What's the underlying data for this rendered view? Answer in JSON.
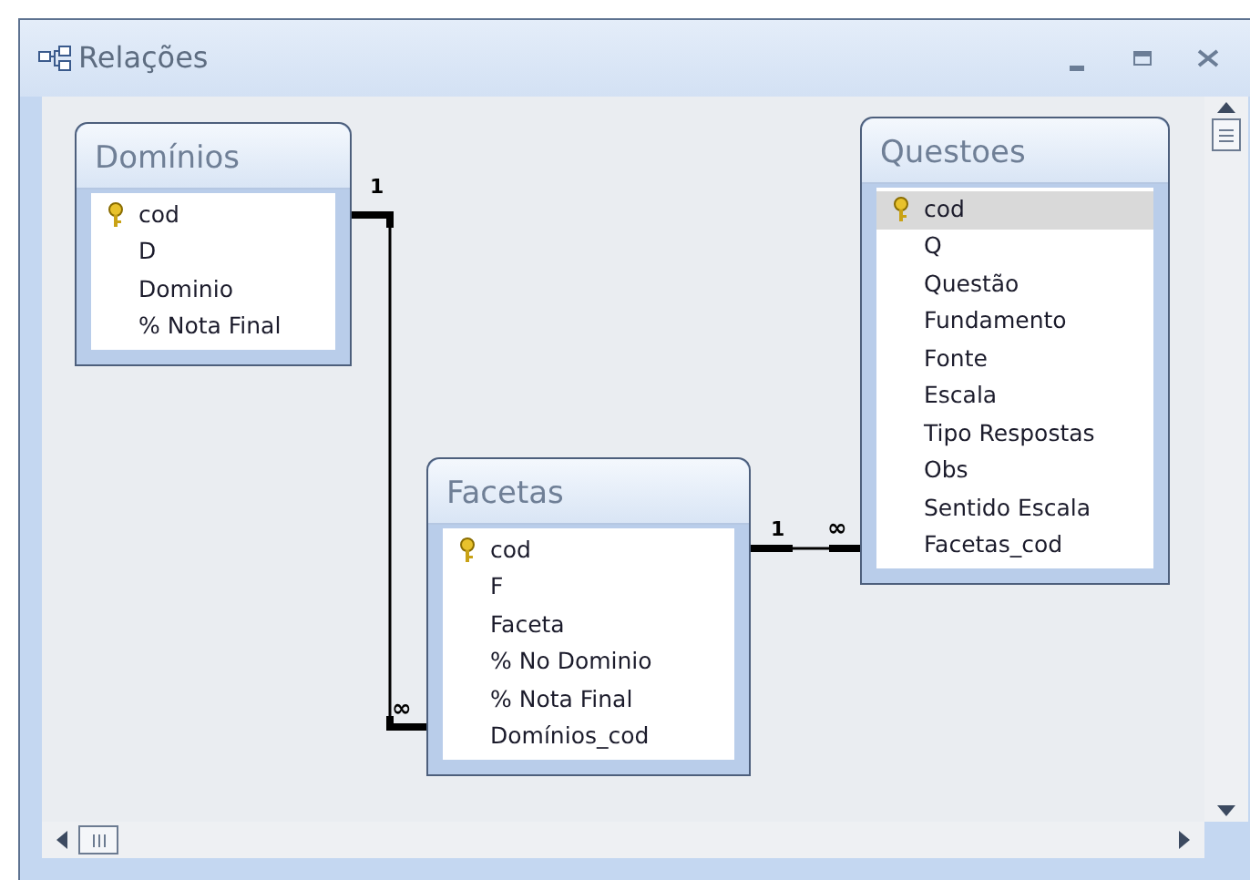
{
  "window": {
    "title": "Relações"
  },
  "tables": [
    {
      "title": "Domínios",
      "fields": [
        {
          "name": "cod",
          "primary_key": true,
          "selected": false
        },
        {
          "name": "D",
          "primary_key": false,
          "selected": false
        },
        {
          "name": "Dominio",
          "primary_key": false,
          "selected": false
        },
        {
          "name": "% Nota Final",
          "primary_key": false,
          "selected": false
        }
      ]
    },
    {
      "title": "Facetas",
      "fields": [
        {
          "name": "cod",
          "primary_key": true,
          "selected": false
        },
        {
          "name": "F",
          "primary_key": false,
          "selected": false
        },
        {
          "name": "Faceta",
          "primary_key": false,
          "selected": false
        },
        {
          "name": "% No Dominio",
          "primary_key": false,
          "selected": false
        },
        {
          "name": "% Nota Final",
          "primary_key": false,
          "selected": false
        },
        {
          "name": "Domínios_cod",
          "primary_key": false,
          "selected": false
        }
      ]
    },
    {
      "title": "Questoes",
      "fields": [
        {
          "name": "cod",
          "primary_key": true,
          "selected": true
        },
        {
          "name": "Q",
          "primary_key": false,
          "selected": false
        },
        {
          "name": "Questão",
          "primary_key": false,
          "selected": false
        },
        {
          "name": "Fundamento",
          "primary_key": false,
          "selected": false
        },
        {
          "name": "Fonte",
          "primary_key": false,
          "selected": false
        },
        {
          "name": "Escala",
          "primary_key": false,
          "selected": false
        },
        {
          "name": "Tipo Respostas",
          "primary_key": false,
          "selected": false
        },
        {
          "name": "Obs",
          "primary_key": false,
          "selected": false
        },
        {
          "name": "Sentido Escala",
          "primary_key": false,
          "selected": false
        },
        {
          "name": "Facetas_cod",
          "primary_key": false,
          "selected": false
        }
      ]
    }
  ],
  "relationships": [
    {
      "one_label": "1",
      "many_label": "∞"
    },
    {
      "one_label": "1",
      "many_label": "∞"
    }
  ]
}
